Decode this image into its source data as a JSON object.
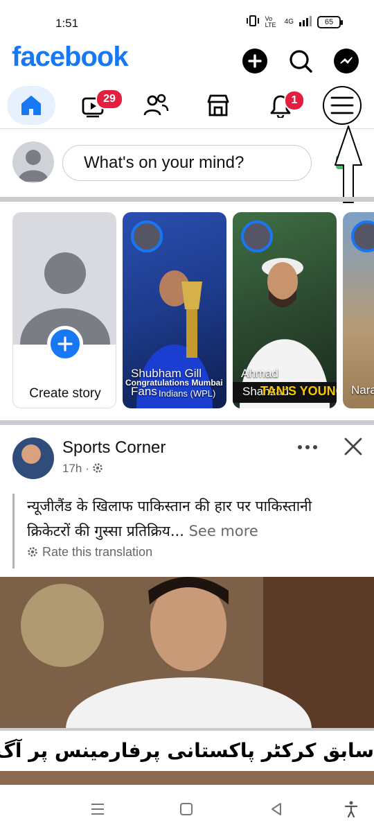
{
  "status_bar": {
    "time": "1:51",
    "battery": "65",
    "network": "4G",
    "volte": "Vo LTE"
  },
  "header": {
    "logo": "facebook",
    "brand_color": "#1877f2"
  },
  "tabs": {
    "video_badge": "29",
    "notifications_badge": "1"
  },
  "composer": {
    "placeholder": "What's on your mind?"
  },
  "stories": [
    {
      "label": "Create story"
    },
    {
      "name": "Shubham Gill",
      "overlay": "Congratulations Mumbai",
      "sub": "Fans",
      "sub2": "Indians (WPL)"
    },
    {
      "name": "Ahmad",
      "sub": "Shahzad",
      "overlay": "TAN'S YOUNG GUN"
    },
    {
      "name": "Nara"
    }
  ],
  "post": {
    "author": "Sports Corner",
    "time": "17h",
    "text": "न्यूजीलैंड के खिलाफ पाकिस्तान की हार पर पाकिस्तानी क्रिकेटरों की गुस्सा प्रतिक्रिय...",
    "see_more": "See more",
    "rate_translation": "Rate this translation",
    "image_caption": "سابق کرکٹر پاکستانی پرفارمینس پر آگ بگولہ"
  }
}
